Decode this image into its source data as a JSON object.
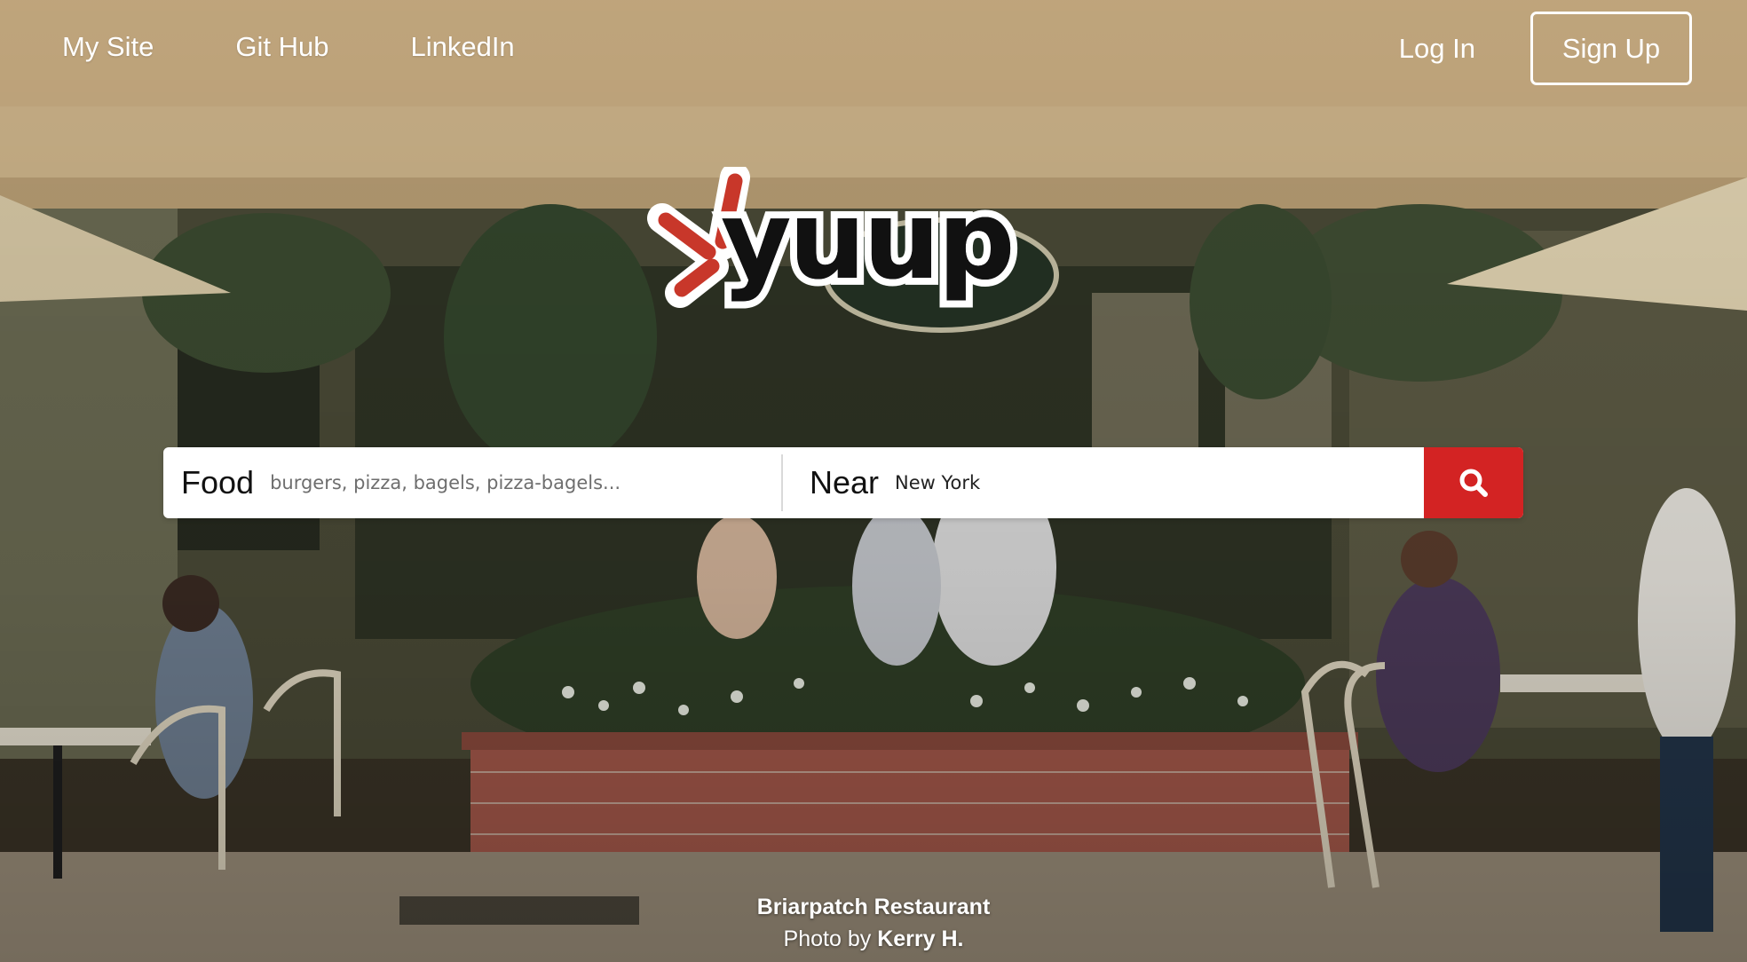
{
  "nav": {
    "links": [
      "My Site",
      "Git Hub",
      "LinkedIn"
    ],
    "login_label": "Log In",
    "signup_label": "Sign Up"
  },
  "logo": {
    "text": "yuup",
    "burst_color": "#c8372a"
  },
  "search": {
    "food_label": "Food",
    "food_placeholder": "burgers, pizza, bagels, pizza-bagels...",
    "food_value": "",
    "near_label": "Near",
    "near_value": "New York",
    "button_icon": "search-icon",
    "button_color": "#d32323"
  },
  "credit": {
    "restaurant": "Briarpatch Restaurant",
    "photo_prefix": "Photo by",
    "photographer": "Kerry H."
  }
}
